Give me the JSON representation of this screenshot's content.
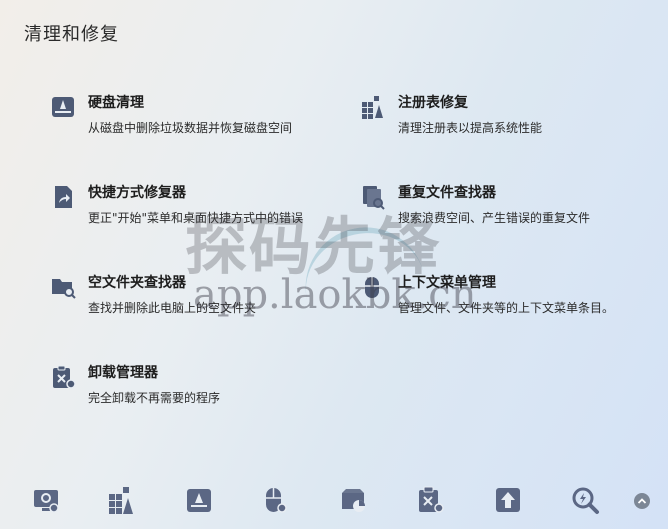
{
  "page": {
    "title": "清理和修复"
  },
  "tools": [
    {
      "name": "硬盘清理",
      "desc": "从磁盘中删除垃圾数据并恢复磁盘空间",
      "icon": "disk-cleanup-icon"
    },
    {
      "name": "注册表修复",
      "desc": "清理注册表以提高系统性能",
      "icon": "registry-fix-icon"
    },
    {
      "name": "快捷方式修复器",
      "desc": "更正\"开始\"菜单和桌面快捷方式中的错误",
      "icon": "shortcut-fix-icon"
    },
    {
      "name": "重复文件查找器",
      "desc": "搜索浪费空间、产生错误的重复文件",
      "icon": "duplicate-finder-icon"
    },
    {
      "name": "空文件夹查找器",
      "desc": "查找并删除此电脑上的空文件夹",
      "icon": "empty-folder-icon"
    },
    {
      "name": "上下文菜单管理",
      "desc": "管理文件、文件夹等的上下文菜单条目。",
      "icon": "context-menu-icon"
    },
    {
      "name": "卸载管理器",
      "desc": "完全卸载不再需要的程序",
      "icon": "uninstall-icon"
    }
  ],
  "bottom_bar": [
    "system-settings-icon",
    "registry-icon",
    "disk-cleanup-icon",
    "mouse-settings-icon",
    "disk-usage-icon",
    "uninstall-icon",
    "upload-icon",
    "search-icon"
  ],
  "watermark": {
    "text": "探码先锋",
    "url": "app.laokbk.cn"
  },
  "colors": {
    "icon": "#4d5a75",
    "accent": "#5b6784"
  }
}
